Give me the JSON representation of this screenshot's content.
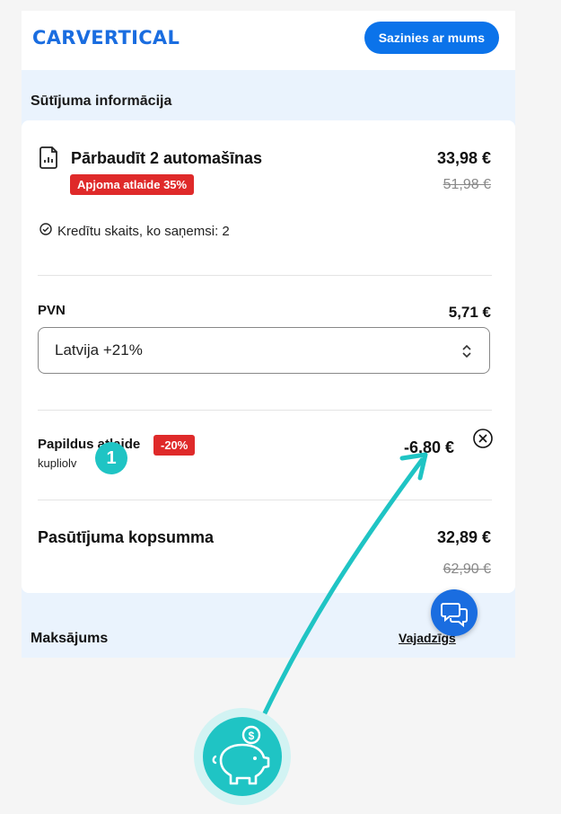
{
  "header": {
    "logo_text": "CARVERTICAL",
    "contact_label": "Sazinies ar mums"
  },
  "order": {
    "section_title": "Sūtījuma informācija",
    "product": {
      "title": "Pārbaudīt 2 automašīnas",
      "price": "33,98 €",
      "old_price": "51,98 €",
      "badge": "Apjoma atlaide 35%",
      "credits_text": "Kredītu skaits, ko saņemsi: 2"
    },
    "vat": {
      "label": "PVN",
      "amount": "5,71 €",
      "country_select": "Latvija +21%"
    },
    "extra_discount": {
      "label": "Papildus atlaide",
      "badge": "-20%",
      "coupon_code": "kupliolv",
      "amount": "-6,80 €"
    },
    "total": {
      "label": "Pasūtījuma kopsumma",
      "amount": "32,89 €",
      "old_amount": "62,90 €"
    }
  },
  "payment": {
    "label": "Maksājums",
    "help_link": "Vajadzīgs"
  },
  "annotation": {
    "step_number": "1"
  },
  "colors": {
    "brand_blue": "#1a6de0",
    "discount_red": "#df2a2a",
    "annotation_teal": "#1fc4c4",
    "page_background": "#eaf3fd"
  },
  "icons": {
    "product": "document-chart-icon",
    "credits": "check-circle-icon",
    "select": "chevron-up-down-icon",
    "remove": "close-circle-icon",
    "chat": "chat-bubbles-icon",
    "annotation": "piggy-bank-coin-icon"
  }
}
